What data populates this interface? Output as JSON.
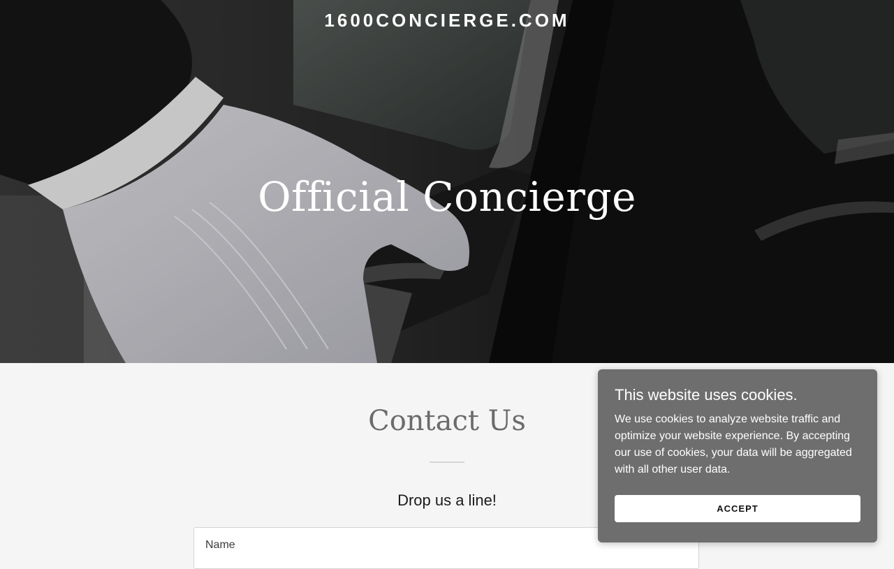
{
  "header": {
    "site_name": "1600CONCIERGE.COM"
  },
  "hero": {
    "title": "Official Concierge",
    "image_alt": "white-gloved hand opening a black car door"
  },
  "contact": {
    "title": "Contact Us",
    "subtitle": "Drop us a line!",
    "form": {
      "name_label": "Name"
    }
  },
  "cookie_banner": {
    "title": "This website uses cookies.",
    "body": "We use cookies to analyze website traffic and optimize your website experience. By accepting our use of cookies, your data will be aggregated with all other user data.",
    "accept_label": "ACCEPT"
  },
  "colors": {
    "page_background": "#f5f5f5",
    "cookie_panel": "#6e6e6e",
    "contact_title": "#6b6b6b"
  }
}
